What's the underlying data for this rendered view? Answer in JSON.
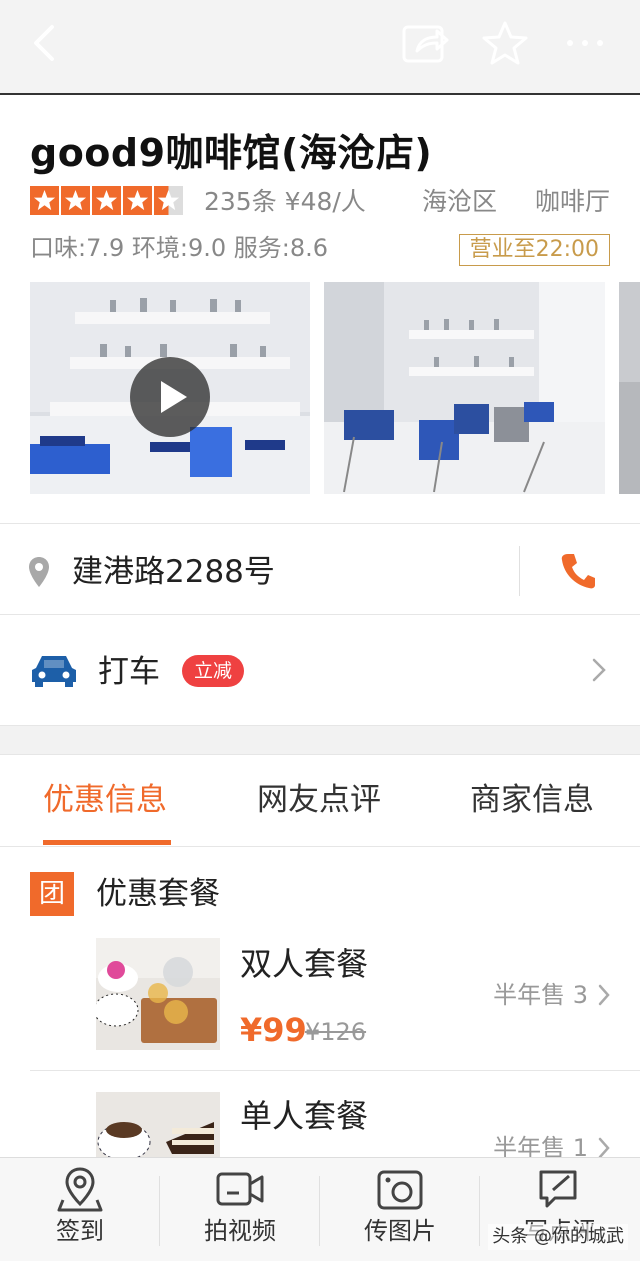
{
  "header": {
    "shop_name": "good9咖啡馆(海沧店)",
    "rating_stars": 4.5,
    "review_count_price": "235条 ¥48/人",
    "district": "海沧区",
    "category": "咖啡厅",
    "scores": "口味:7.9 环境:9.0 服务:8.6",
    "hours": "营业至22:00"
  },
  "address": {
    "text": "建港路2288号"
  },
  "taxi": {
    "label": "打车",
    "badge": "立减"
  },
  "tabs": [
    {
      "label": "优惠信息",
      "active": true
    },
    {
      "label": "网友点评",
      "active": false
    },
    {
      "label": "商家信息",
      "active": false
    }
  ],
  "deals": {
    "section_icon": "团",
    "section_title": "优惠套餐",
    "items": [
      {
        "name": "双人套餐",
        "price": "¥99",
        "original_price": "¥126",
        "sold": "半年售 3"
      },
      {
        "name": "单人套餐",
        "sold": "半年售 1"
      }
    ]
  },
  "bottom_bar": [
    {
      "label": "签到",
      "icon": "location-pin-icon"
    },
    {
      "label": "拍视频",
      "icon": "video-camera-icon"
    },
    {
      "label": "传图片",
      "icon": "photo-upload-icon"
    },
    {
      "label": "写点评",
      "icon": "write-review-icon"
    }
  ],
  "watermark": "头条 @你的城武",
  "colors": {
    "accent": "#f06a2b",
    "badge_red": "#ef4141",
    "hours_gold": "#c89b4b",
    "car_blue": "#1d5fa8"
  }
}
